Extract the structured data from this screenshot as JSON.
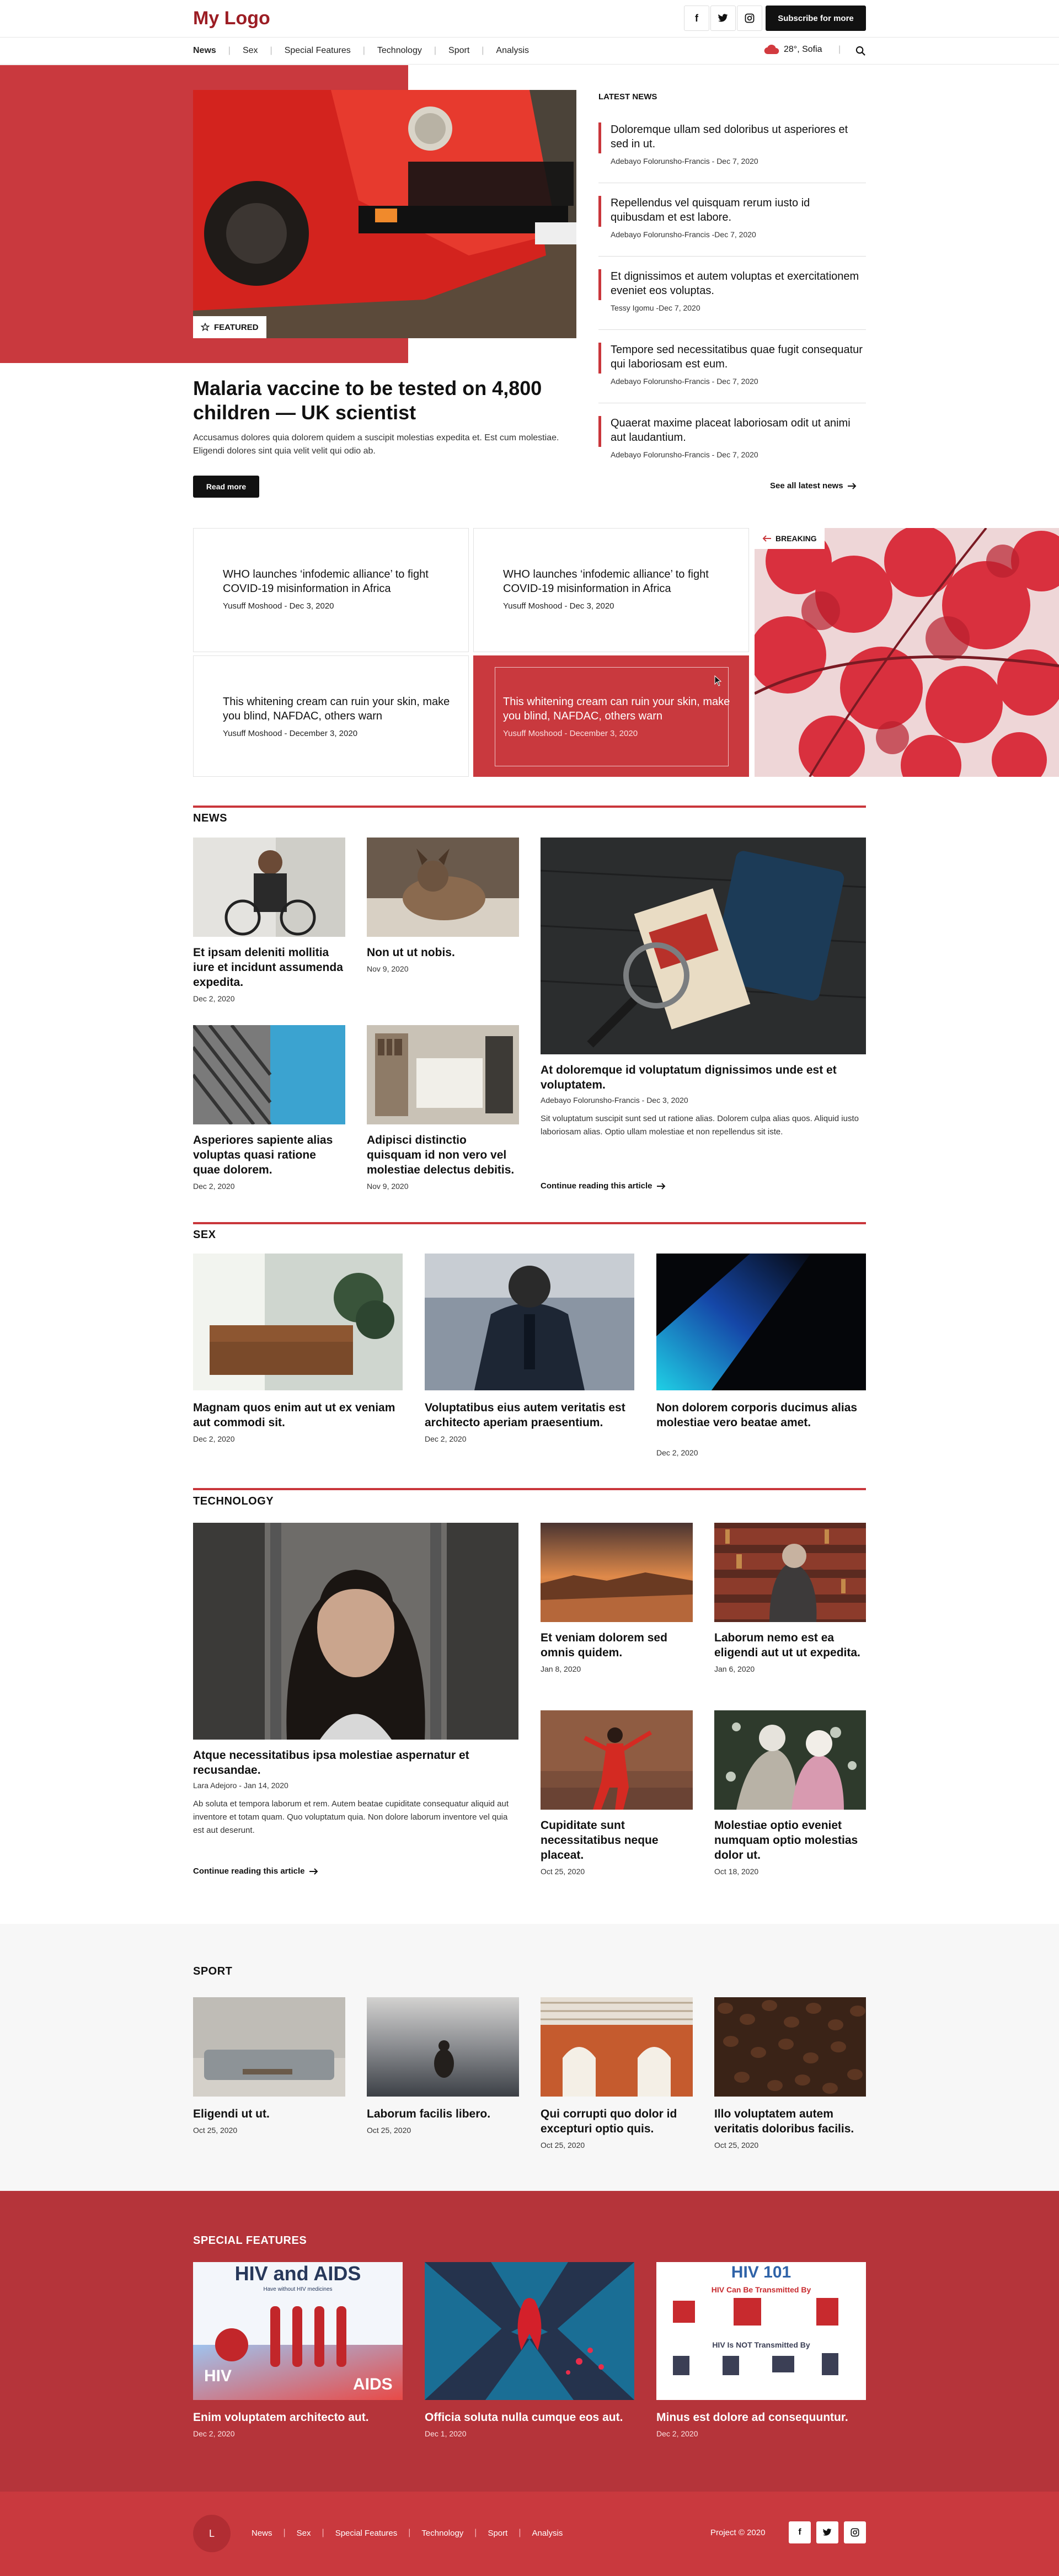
{
  "header": {
    "logo": "My Logo",
    "subscribe_label": "Subscribe for more",
    "social": [
      "facebook-icon",
      "twitter-icon",
      "instagram-icon"
    ]
  },
  "nav": {
    "items": [
      "News",
      "Sex",
      "Special Features",
      "Technology",
      "Sport",
      "Analysis"
    ],
    "active": "News",
    "weather": "28°, Sofia"
  },
  "hero": {
    "badge": "FEATURED",
    "title": "Malaria vaccine to be tested on 4,800 children — UK scientist",
    "text": "Accusamus dolores quia dolorem quidem a suscipit molestias expedita et. Est cum molestiae. Eligendi dolores sint quia velit velit qui odio ab.",
    "read_more": "Read more"
  },
  "latest": {
    "heading": "LATEST NEWS",
    "items": [
      {
        "title": "Doloremque ullam sed doloribus ut asperiores et sed in ut.",
        "meta": "Adebayo Folorunsho-Francis - Dec 7, 2020"
      },
      {
        "title": "Repellendus vel quisquam rerum iusto id quibusdam et est labore.",
        "meta": "Adebayo Folorunsho-Francis -Dec 7, 2020"
      },
      {
        "title": "Et dignissimos et autem voluptas et exercitationem eveniet eos voluptas.",
        "meta": "Tessy Igomu -Dec 7, 2020"
      },
      {
        "title": "Tempore sed necessitatibus quae fugit consequatur qui laboriosam est eum.",
        "meta": "Adebayo Folorunsho-Francis - Dec 7, 2020"
      },
      {
        "title": "Quaerat maxime placeat laboriosam odit ut animi aut laudantium.",
        "meta": "Adebayo Folorunsho-Francis - Dec 7, 2020"
      }
    ],
    "see_all": "See all latest news"
  },
  "breaking": {
    "badge": "BREAKING",
    "cards": [
      {
        "title": "WHO launches ‘infodemic alliance’ to fight COVID-19 misinformation in Africa",
        "meta": "Yusuff Moshood - Dec 3, 2020"
      },
      {
        "title": "WHO launches ‘infodemic alliance’ to fight COVID-19 misinformation in Africa",
        "meta": "Yusuff Moshood - Dec 3, 2020"
      },
      {
        "title": "This whitening cream can ruin your skin, make you blind, NAFDAC, others warn",
        "meta": "Yusuff Moshood - December 3, 2020"
      },
      {
        "title": "This whitening cream can ruin your skin, make you blind, NAFDAC, others warn",
        "meta": "Yusuff Moshood - December 3, 2020"
      }
    ]
  },
  "news": {
    "heading": "NEWS",
    "small": [
      {
        "title": "Et ipsam deleniti mollitia iure et incidunt assumenda expedita.",
        "date": "Dec 2, 2020"
      },
      {
        "title": "Non ut ut nobis.",
        "date": "Nov 9, 2020"
      },
      {
        "title": "Asperiores sapiente alias voluptas quasi ratione quae dolorem.",
        "date": "Dec 2, 2020"
      },
      {
        "title": "Adipisci distinctio quisquam id non vero vel molestiae delectus debitis.",
        "date": "Nov 9, 2020"
      }
    ],
    "big": {
      "title": "At doloremque id voluptatum dignissimos unde est et voluptatem.",
      "meta": "Adebayo Folorunsho-Francis - Dec 3, 2020",
      "text": "Sit voluptatum suscipit sunt sed ut ratione alias. Dolorem culpa alias quos. Aliquid iusto laboriosam alias. Optio ullam molestiae et non repellendus sit iste.",
      "link": "Continue reading this article"
    }
  },
  "sex": {
    "heading": "SEX",
    "items": [
      {
        "title": "Magnam quos enim aut ut ex veniam aut commodi sit.",
        "date": "Dec 2, 2020"
      },
      {
        "title": "Voluptatibus eius autem veritatis est architecto aperiam praesentium.",
        "date": "Dec 2, 2020"
      },
      {
        "title": "Non dolorem corporis ducimus alias molestiae vero beatae amet.",
        "date": "Dec 2, 2020"
      }
    ]
  },
  "technology": {
    "heading": "TECHNOLOGY",
    "big": {
      "title": "Atque necessitatibus ipsa molestiae aspernatur et recusandae.",
      "meta": "Lara Adejoro - Jan 14, 2020",
      "text": "Ab soluta et tempora laborum et rem. Autem beatae cupiditate consequatur aliquid aut inventore et totam quam. Quo voluptatum quia. Non dolore laborum inventore vel quia est aut deserunt.",
      "link": "Continue reading this article"
    },
    "small": [
      {
        "title": "Et veniam dolorem sed omnis quidem.",
        "date": "Jan 8, 2020"
      },
      {
        "title": "Laborum nemo est ea eligendi aut ut ut expedita.",
        "date": "Jan 6, 2020"
      },
      {
        "title": "Cupiditate sunt necessitatibus neque placeat.",
        "date": "Oct 25, 2020"
      },
      {
        "title": "Molestiae optio eveniet numquam optio molestias dolor ut.",
        "date": "Oct 18, 2020"
      }
    ]
  },
  "sport": {
    "heading": "SPORT",
    "items": [
      {
        "title": "Eligendi ut ut.",
        "date": "Oct 25, 2020"
      },
      {
        "title": "Laborum facilis libero.",
        "date": "Oct 25, 2020"
      },
      {
        "title": "Qui corrupti quo dolor id excepturi optio quis.",
        "date": "Oct 25, 2020"
      },
      {
        "title": "Illo voluptatem autem veritatis doloribus facilis.",
        "date": "Oct 25, 2020"
      }
    ]
  },
  "special": {
    "heading": "SPECIAL FEATURES",
    "items": [
      {
        "title": "Enim voluptatem architecto aut.",
        "date": "Dec 2, 2020"
      },
      {
        "title": "Officia soluta nulla cumque eos aut.",
        "date": "Dec 1, 2020"
      },
      {
        "title": "Minus est dolore ad consequuntur.",
        "date": "Dec 2, 2020"
      }
    ],
    "img1": {
      "title": "HIV and AIDS",
      "sub": "Have without HIV medicines",
      "label_left": "HIV",
      "label_right": "AIDS"
    },
    "img3": {
      "title": "HIV 101",
      "line1": "HIV Can Be Transmitted By",
      "line2": "HIV Is NOT Transmitted By"
    }
  },
  "footer": {
    "avatar": "L",
    "links": [
      "News",
      "Sex",
      "Special Features",
      "Technology",
      "Sport",
      "Analysis"
    ],
    "copyright": "Project © 2020"
  },
  "colors": {
    "accent": "#c9363b",
    "dark_red": "#b5343a",
    "footer_red": "#c9393e"
  }
}
